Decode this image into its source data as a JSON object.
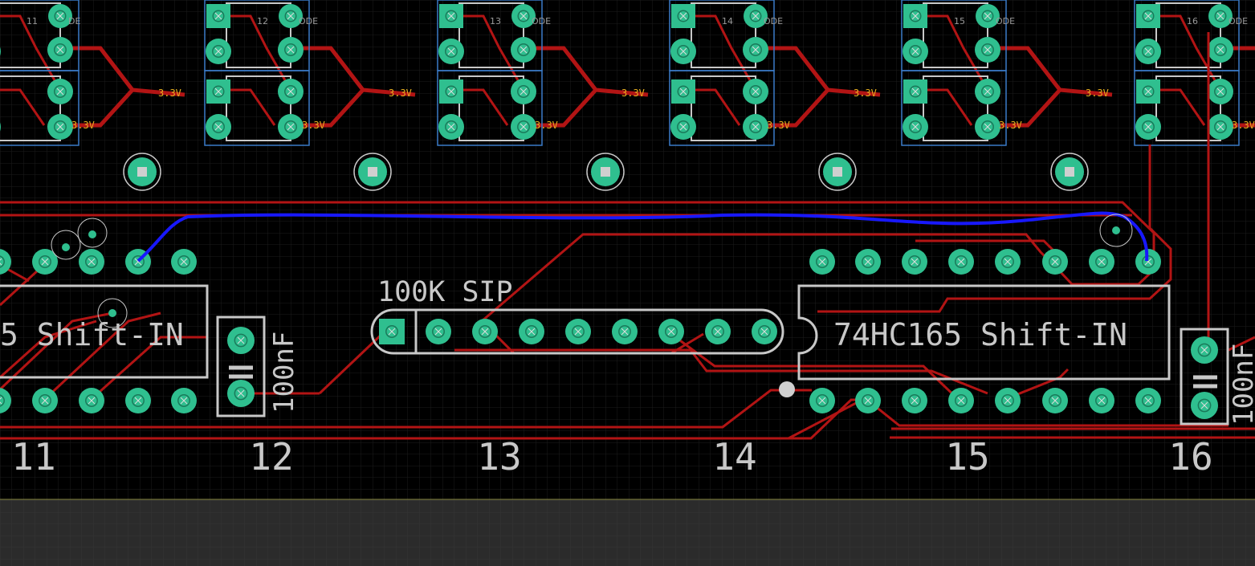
{
  "editor": {
    "grid_color": "#1c1c1c",
    "background": "#000000",
    "lower_pane_color": "#2b2b2b",
    "top_trace_color": "#b21414",
    "airwire_color": "#1818ff",
    "pad_color": "#2fbf8f",
    "outline_color": "#c8c8c8",
    "label_color": "#e8b020",
    "footprint_box_color": "#3a7bc8"
  },
  "net_label": "3.3V",
  "led_row": [
    {
      "num": "11",
      "tag": "11",
      "suffix": "DE"
    },
    {
      "num": "12",
      "tag": "12",
      "suffix": "ODE"
    },
    {
      "num": "13",
      "tag": "13",
      "suffix": "ODE"
    },
    {
      "num": "14",
      "tag": "14",
      "suffix": "ODE"
    },
    {
      "num": "15",
      "tag": "15",
      "suffix": "ODE"
    },
    {
      "num": "16",
      "tag": "16",
      "suffix": "ODE"
    }
  ],
  "parts": {
    "ic_left_label": "5 Shift-IN",
    "ic_right_label": "74HC165 Shift-IN",
    "sip_label": "100K SIP",
    "cap_left_label": "100nF",
    "cap_right_label": "100nF"
  },
  "column_numbers": [
    "11",
    "12",
    "13",
    "14",
    "15",
    "16"
  ]
}
